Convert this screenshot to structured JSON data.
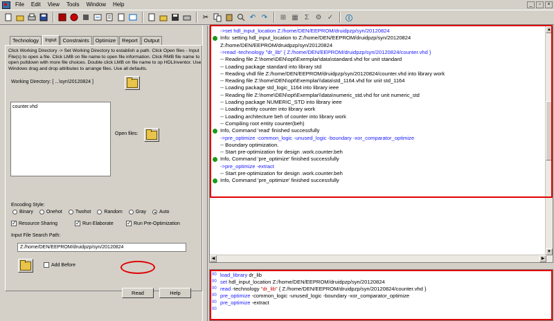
{
  "menu": [
    "File",
    "Edit",
    "View",
    "Tools",
    "Window",
    "Help"
  ],
  "toolbar_icons": [
    "open-icon",
    "save-icon",
    "cut-icon",
    "copy-icon",
    "paste-icon",
    "undo-icon",
    "redo-icon",
    "chip-icon",
    "run-icon",
    "stop-icon",
    "schematic-icon",
    "sum-icon",
    "settings-icon",
    "info-icon"
  ],
  "tabs": [
    "Technology",
    "Input",
    "Constraints",
    "Optimize",
    "Report",
    "Output"
  ],
  "active_tab": "Input",
  "instructions": "Click Working Directory -> Set Working Directory to establish a path. Click Open files - Input File(s) to open a file. Click LMB on file name to open file information. Click RMB file name to open pulldown with more file choices. Double click LMB on file name to op HDLInventor. Use Windows drag and drop attributes to arrange files. Use all defaults.",
  "working_directory_label": "Working Directory: [ ...\\syn\\20120824 ]",
  "file_list": [
    "counter.vhd"
  ],
  "open_files_label": "Open files:",
  "encoding": {
    "label": "Encoding Style:",
    "options": [
      "Binary",
      "Onehot",
      "Twohot",
      "Random",
      "Gray",
      "Auto"
    ],
    "selected": "Auto"
  },
  "checks": {
    "resource_sharing": "Resource Sharing",
    "run_elaborate": "Run Elaborate",
    "run_pre_optimization": "Run Pre-Optimization"
  },
  "search_path_label": "Input File Search Path:",
  "search_path_value": "Z:/home/DEN/EEPROM/druidpzp/syn/20120824",
  "add_before": "Add Before",
  "buttons": {
    "read": "Read",
    "help": "Help"
  },
  "log": [
    {
      "kind": "cmd",
      "text": "->set hdl_input_location Z:/home/DEN/EEPROM/druidpzp/syn/20120824"
    },
    {
      "kind": "info",
      "text": "Info: setting hdl_input_location to Z:/home/DEN/EEPROM/druidpzp/syn/20120824"
    },
    {
      "kind": "plain",
      "text": "Z:/home/DEN/EEPROM/druidpzp/syn/20120824"
    },
    {
      "kind": "cmd",
      "text": "->read -technology \"dr_lib\"  { Z:/home/DEN/EEPROM/druidpzp/syn/20120824/counter.vhd }"
    },
    {
      "kind": "plain",
      "text": "-- Reading file Z:\\home\\DEN\\opt\\Exemplar\\data\\standard.vhd for unit standard"
    },
    {
      "kind": "plain",
      "text": "-- Loading package standard into library std"
    },
    {
      "kind": "plain",
      "text": "-- Reading vhdl file Z:/home/DEN/EEPROM/druidpzp/syn/20120824/counter.vhd into library work"
    },
    {
      "kind": "plain",
      "text": "-- Reading file Z:\\home\\DEN\\opt\\Exemplar\\\\data\\std_1164.vhd for unit std_1164"
    },
    {
      "kind": "plain",
      "text": "-- Loading package std_logic_1164 into library ieee"
    },
    {
      "kind": "plain",
      "text": "-- Reading file Z:\\home\\DEN\\opt\\Exemplar\\\\data\\numeric_std.vhd for unit numeric_std"
    },
    {
      "kind": "plain",
      "text": "-- Loading package NUMERIC_STD into library ieee"
    },
    {
      "kind": "plain",
      "text": "-- Loading entity counter into library work"
    },
    {
      "kind": "plain",
      "text": "-- Loading architecture beh of counter into library work"
    },
    {
      "kind": "plain",
      "text": "-- Compiling root entity counter(beh)"
    },
    {
      "kind": "info",
      "text": "Info, Command 'read' finished successfully"
    },
    {
      "kind": "cmd",
      "text": "->pre_optimize -common_logic -unused_logic -boundary -xor_comparator_optimize"
    },
    {
      "kind": "plain",
      "text": "-- Boundary optimization."
    },
    {
      "kind": "plain",
      "text": "-- Start pre-optimization for design .work.counter.beh"
    },
    {
      "kind": "info",
      "text": "Info, Command 'pre_optimize' finished successfully"
    },
    {
      "kind": "cmd",
      "text": "->pre_optimize -extract"
    },
    {
      "kind": "plain",
      "text": "-- Start pre-optimization for design .work.counter.beh"
    },
    {
      "kind": "info",
      "text": "Info, Command 'pre_optimize' finished successfully"
    }
  ],
  "command_window": {
    "line_numbers": [
      "00",
      "00",
      "00",
      "00",
      "00",
      "00"
    ],
    "lines": [
      {
        "kw": "load_library",
        "rest": " dr_lib"
      },
      {
        "kw": "set",
        "rest": " hdl_input_location Z:/home/DEN/EEPROM/druidpzp/syn/20120824"
      },
      {
        "kw": "read",
        "rest": " -technology ",
        "str": "\"dr_lib\"",
        "rest2": "  { Z:/home/DEN/EEPROM/druidpzp/syn/20120824/counter.vhd }"
      },
      {
        "kw": "pre_optimize",
        "rest": " -common_logic -unused_logic -boundary -xor_comparator_optimize"
      },
      {
        "kw": "pre_optimize",
        "rest": " -extract"
      },
      {
        "kw": "",
        "rest": ""
      }
    ]
  }
}
